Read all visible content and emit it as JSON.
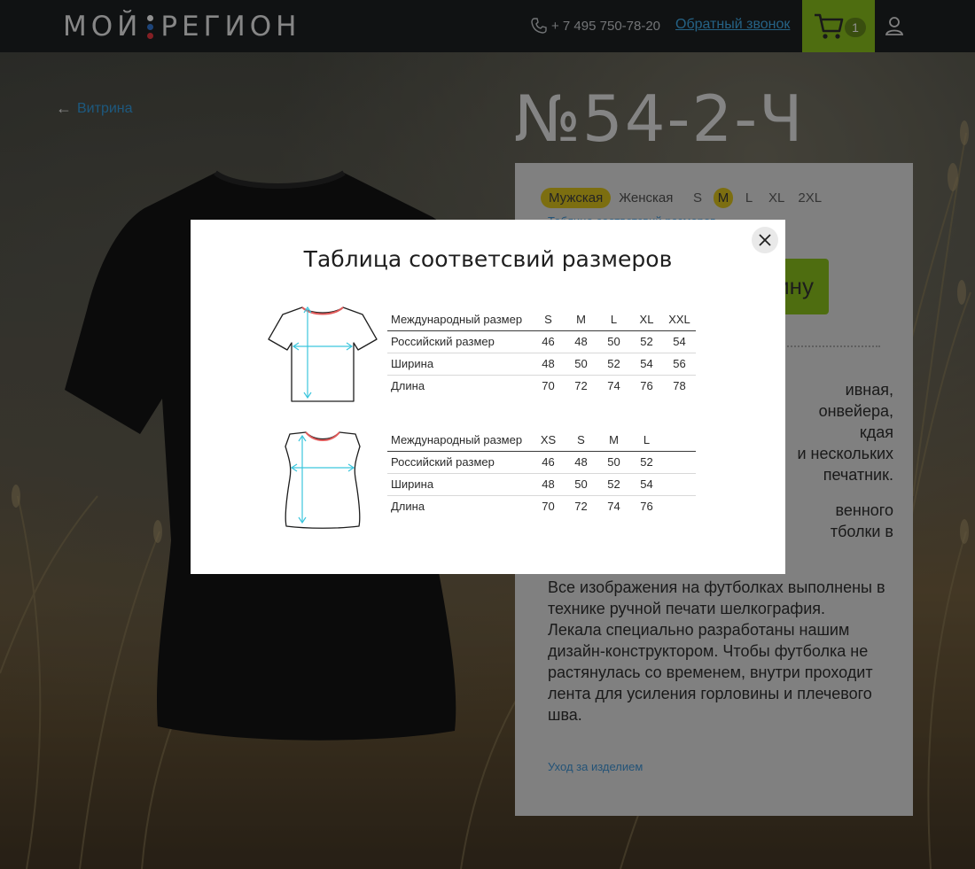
{
  "header": {
    "logo_left": "МОЙ",
    "logo_right": "РЕГИОН",
    "phone": "+ 7 495 750-78-20",
    "callback_label": "Обратный звонок",
    "cart_count": "1"
  },
  "back_link": "Витрина",
  "product": {
    "title": "№54-2-Ч",
    "gender_options": [
      "Мужская",
      "Женская"
    ],
    "sizes": [
      "S",
      "M",
      "L",
      "XL",
      "2XL"
    ],
    "size_table_link": "Таблица соответсвий размеров",
    "buy_label": "ину",
    "desc_a": "ивная,\nонвейера,\nкдая\nи нескольких\n печатник.",
    "desc_b": "венного\nтболки в",
    "desc_c": "Все изображения на футболках выполнены в технике ручной печати шелкография.\nЛекала специально разработаны нашим дизайн-конструктором. Чтобы футболка не растянулась со временем, внутри проходит лента для усиления горловины и плечевого шва.",
    "care_link": "Уход за изделием"
  },
  "modal": {
    "title": "Таблица соответсвий размеров",
    "male_table": {
      "header_label": "Международный размер",
      "sizes": [
        "S",
        "M",
        "L",
        "XL",
        "XXL"
      ],
      "rows": [
        {
          "label": "Российский размер",
          "values": [
            "46",
            "48",
            "50",
            "52",
            "54"
          ]
        },
        {
          "label": "Ширина",
          "values": [
            "48",
            "50",
            "52",
            "54",
            "56"
          ]
        },
        {
          "label": "Длина",
          "values": [
            "70",
            "72",
            "74",
            "76",
            "78"
          ]
        }
      ]
    },
    "female_table": {
      "header_label": "Международный размер",
      "sizes": [
        "XS",
        "S",
        "M",
        "L"
      ],
      "rows": [
        {
          "label": "Российский размер",
          "values": [
            "46",
            "48",
            "50",
            "52"
          ]
        },
        {
          "label": "Ширина",
          "values": [
            "48",
            "50",
            "52",
            "54"
          ]
        },
        {
          "label": "Длина",
          "values": [
            "70",
            "72",
            "74",
            "76"
          ]
        }
      ]
    }
  },
  "colors": {
    "header_bg": "#1a1d20",
    "accent_green": "#7fb01a",
    "link_blue": "#2f8fcb",
    "selected_yellow": "#c9b21b",
    "diagram_cyan": "#3cc6dd",
    "collar_red": "#e05a5a"
  }
}
